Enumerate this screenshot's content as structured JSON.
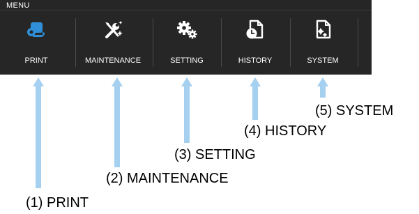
{
  "menu": {
    "title": "MENU",
    "accent_color": "#2f8fd8",
    "tabs": [
      {
        "label": "PRINT",
        "icon": "print-icon",
        "selected": true
      },
      {
        "label": "MAINTENANCE",
        "icon": "maintenance-tools-icon",
        "selected": false
      },
      {
        "label": "SETTING",
        "icon": "gears-icon",
        "selected": false
      },
      {
        "label": "HISTORY",
        "icon": "history-clock-icon",
        "selected": false
      },
      {
        "label": "SYSTEM",
        "icon": "system-document-icon",
        "selected": false
      }
    ]
  },
  "callouts": [
    {
      "text": "(1) PRINT"
    },
    {
      "text": "(2) MAINTENANCE"
    },
    {
      "text": "(3) SETTING"
    },
    {
      "text": "(4) HISTORY"
    },
    {
      "text": "(5) SYSTEM"
    }
  ],
  "colors": {
    "arrow": "#a6d0f0",
    "bar": "#262626",
    "text": "#ffffff"
  }
}
